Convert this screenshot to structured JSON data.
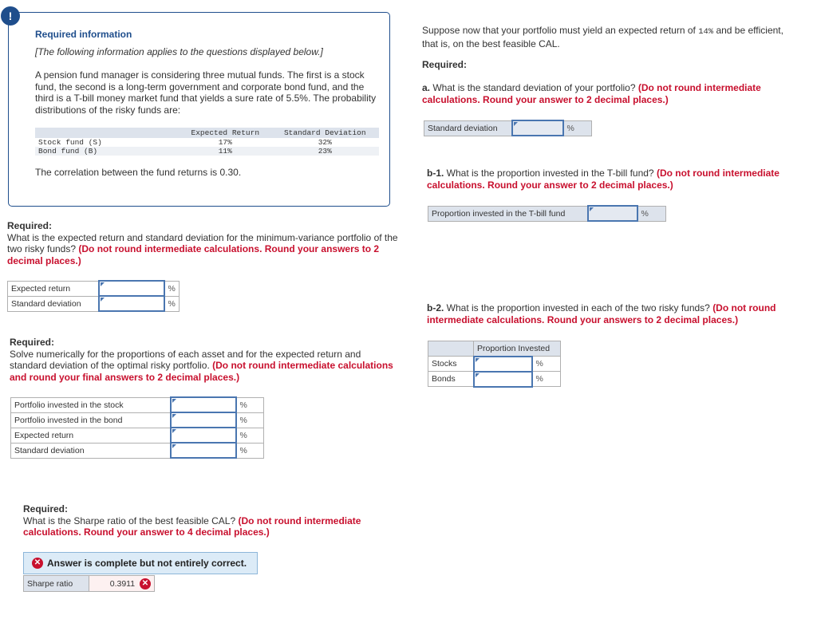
{
  "info": {
    "badge": "!",
    "title": "Required information",
    "subtitle": "[The following information applies to the questions displayed below.]",
    "body": "A pension fund manager is considering three mutual funds. The first is a stock fund, the second is a long-term government and corporate bond fund, and the third is a T-bill money market fund that yields a sure rate of 5.5%. The probability distributions of the risky funds are:",
    "table": {
      "headers": [
        "",
        "Expected Return",
        "Standard Deviation"
      ],
      "rows": [
        {
          "label": "Stock fund (S)",
          "expected_return": "17%",
          "std_dev": "32%"
        },
        {
          "label": "Bond fund (B)",
          "expected_return": "11%",
          "std_dev": "23%"
        }
      ]
    },
    "correlation": "The correlation between the fund returns is 0.30."
  },
  "q1": {
    "required": "Required:",
    "question": "What is the expected return and standard deviation for the minimum-variance portfolio of the two risky funds? ",
    "instruction": "(Do not round intermediate calculations. Round your answers to 2 decimal places.)",
    "rows": [
      {
        "label": "Expected return",
        "value": "",
        "unit": "%"
      },
      {
        "label": "Standard deviation",
        "value": "",
        "unit": "%"
      }
    ]
  },
  "q2": {
    "required": "Required:",
    "question": "Solve numerically for the proportions of each asset and for the expected return and standard deviation of the optimal risky portfolio. ",
    "instruction": "(Do not round intermediate calculations and round your final answers to 2 decimal places.)",
    "rows": [
      {
        "label": "Portfolio invested in the stock",
        "value": "",
        "unit": "%"
      },
      {
        "label": "Portfolio invested in the bond",
        "value": "",
        "unit": "%"
      },
      {
        "label": "Expected return",
        "value": "",
        "unit": "%"
      },
      {
        "label": "Standard deviation",
        "value": "",
        "unit": "%"
      }
    ]
  },
  "q3": {
    "required": "Required:",
    "question": "What is the Sharpe ratio of the best feasible CAL? ",
    "instruction": "(Do not round intermediate calculations. Round your answer to 4 decimal places.)",
    "banner": "Answer is complete but not entirely correct.",
    "row": {
      "label": "Sharpe ratio",
      "value": "0.3911",
      "status": "incorrect"
    }
  },
  "right": {
    "intro_before": "Suppose now that your portfolio must yield an expected return of ",
    "intro_value": "14%",
    "intro_after": " and be efficient, that is, on the best feasible CAL.",
    "required": "Required:",
    "a": {
      "prefix": "a.",
      "question": " What is the standard deviation of your portfolio? ",
      "instruction": "(Do not round intermediate calculations. Round your answer to 2 decimal places.)",
      "row": {
        "label": "Standard deviation",
        "value": "",
        "unit": "%"
      }
    },
    "b1": {
      "prefix": "b-1.",
      "question": " What is the proportion invested in the T-bill fund? ",
      "instruction": "(Do not round intermediate calculations. Round your answer to 2 decimal places.)",
      "row": {
        "label": "Proportion invested in the T-bill fund",
        "value": "",
        "unit": "%"
      }
    },
    "b2": {
      "prefix": "b-2.",
      "question": " What is the proportion invested in each of the two risky funds? ",
      "instruction": "(Do not round intermediate calculations. Round your answers to 2 decimal places.)",
      "header": "Proportion Invested",
      "rows": [
        {
          "label": "Stocks",
          "value": "",
          "unit": "%"
        },
        {
          "label": "Bonds",
          "value": "",
          "unit": "%"
        }
      ]
    }
  },
  "colors": {
    "accent_blue": "#1f4e8c",
    "instruction_red": "#c8102e",
    "input_border": "#4a76b0",
    "banner_bg": "#dcebf7"
  }
}
